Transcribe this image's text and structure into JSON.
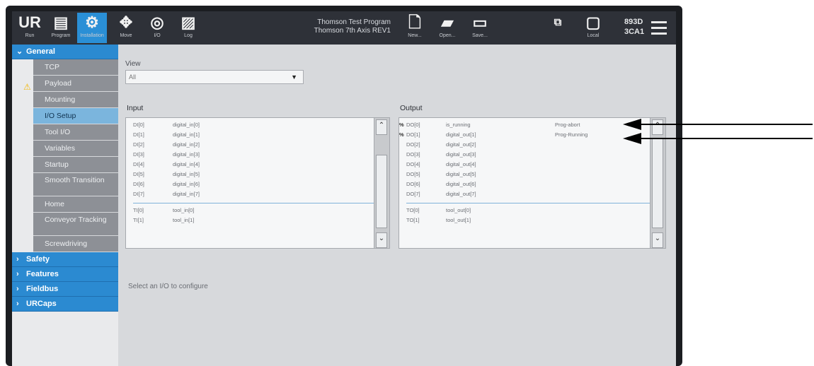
{
  "topbar": {
    "tabs": [
      {
        "icon": "UR",
        "label": "Run"
      },
      {
        "icon": "▤",
        "label": "Program"
      },
      {
        "icon": "⚙",
        "label": "Installation"
      },
      {
        "icon": "✥",
        "label": "Move"
      },
      {
        "icon": "◎",
        "label": "I/O"
      },
      {
        "icon": "▨",
        "label": "Log"
      }
    ],
    "program_name": "Thomson Test Program",
    "installation_name": "Thomson 7th Axis REV1",
    "file_buttons": [
      {
        "icon": "🗋",
        "label": "New..."
      },
      {
        "icon": "▰",
        "label": "Open..."
      },
      {
        "icon": "▭",
        "label": "Save..."
      }
    ],
    "local_label": "Local",
    "serial_line1": "893D",
    "serial_line2": "3CA1"
  },
  "sidebar": {
    "general_label": "General",
    "items": [
      {
        "label": "TCP"
      },
      {
        "label": "Payload",
        "warning": true
      },
      {
        "label": "Mounting"
      },
      {
        "label": "I/O Setup",
        "selected": true
      },
      {
        "label": "Tool I/O"
      },
      {
        "label": "Variables"
      },
      {
        "label": "Startup"
      },
      {
        "label": "Smooth Transition",
        "two": true
      },
      {
        "label": "Home"
      },
      {
        "label": "Conveyor Tracking",
        "two": true
      },
      {
        "label": "Screwdriving"
      }
    ],
    "sections": [
      {
        "label": "Safety"
      },
      {
        "label": "Features"
      },
      {
        "label": "Fieldbus"
      },
      {
        "label": "URCaps"
      }
    ]
  },
  "content": {
    "view_label": "View",
    "view_value": "All",
    "input_label": "Input",
    "output_label": "Output",
    "hint": "Select an I/O to configure",
    "inputs": [
      {
        "id": "DI[0]",
        "name": "digital_in[0]"
      },
      {
        "id": "DI[1]",
        "name": "digital_in[1]"
      },
      {
        "id": "DI[2]",
        "name": "digital_in[2]"
      },
      {
        "id": "DI[3]",
        "name": "digital_in[3]"
      },
      {
        "id": "DI[4]",
        "name": "digital_in[4]"
      },
      {
        "id": "DI[5]",
        "name": "digital_in[5]"
      },
      {
        "id": "DI[6]",
        "name": "digital_in[6]"
      },
      {
        "id": "DI[7]",
        "name": "digital_in[7]"
      }
    ],
    "tool_inputs": [
      {
        "id": "TI[0]",
        "name": "tool_in[0]"
      },
      {
        "id": "TI[1]",
        "name": "tool_in[1]"
      }
    ],
    "outputs": [
      {
        "mark": "%",
        "id": "DO[0]",
        "name": "is_running",
        "action": "Prog-abort"
      },
      {
        "mark": "%",
        "id": "DO[1]",
        "name": "digital_out[1]",
        "action": "Prog-Running"
      },
      {
        "mark": "",
        "id": "DO[2]",
        "name": "digital_out[2]",
        "action": ""
      },
      {
        "mark": "",
        "id": "DO[3]",
        "name": "digital_out[3]",
        "action": ""
      },
      {
        "mark": "",
        "id": "DO[4]",
        "name": "digital_out[4]",
        "action": ""
      },
      {
        "mark": "",
        "id": "DO[5]",
        "name": "digital_out[5]",
        "action": ""
      },
      {
        "mark": "",
        "id": "DO[6]",
        "name": "digital_out[6]",
        "action": ""
      },
      {
        "mark": "",
        "id": "DO[7]",
        "name": "digital_out[7]",
        "action": ""
      }
    ],
    "tool_outputs": [
      {
        "id": "TO[0]",
        "name": "tool_out[0]"
      },
      {
        "id": "TO[1]",
        "name": "tool_out[1]"
      }
    ]
  }
}
